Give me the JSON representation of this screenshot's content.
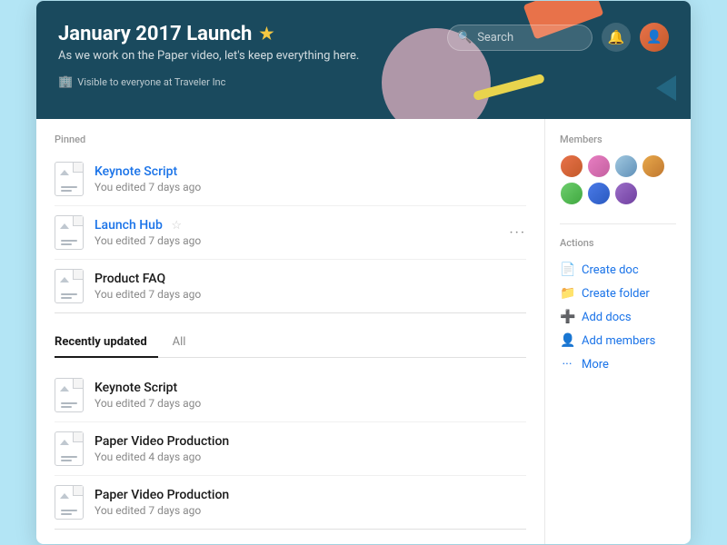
{
  "header": {
    "title": "January 2017 Launch",
    "star": "★",
    "subtitle": "As we work on the Paper video, let's keep everything here.",
    "visibility": "Visible to everyone at Traveler Inc",
    "search_placeholder": "Search",
    "search_label": "Search"
  },
  "pinned": {
    "label": "Pinned",
    "items": [
      {
        "name": "Keynote Script",
        "meta": "You edited 7 days ago",
        "linked": true,
        "has_star": false,
        "has_more": false
      },
      {
        "name": "Launch Hub",
        "meta": "You edited 7 days ago",
        "linked": true,
        "has_star": true,
        "has_more": true
      },
      {
        "name": "Product FAQ",
        "meta": "You edited 7 days ago",
        "linked": false,
        "has_star": false,
        "has_more": false
      }
    ]
  },
  "recently_updated": {
    "tab_recent": "Recently updated",
    "tab_all": "All",
    "items": [
      {
        "name": "Keynote Script",
        "meta": "You edited 7 days ago"
      },
      {
        "name": "Paper Video Production",
        "meta": "You edited 4 days ago"
      },
      {
        "name": "Paper Video Production",
        "meta": "You edited 7 days ago"
      }
    ]
  },
  "sidebar": {
    "members_label": "Members",
    "actions_label": "Actions",
    "actions": [
      {
        "label": "Create doc",
        "icon": "📄"
      },
      {
        "label": "Create folder",
        "icon": "📁"
      },
      {
        "label": "Add docs",
        "icon": "➕"
      },
      {
        "label": "Add members",
        "icon": "👤"
      },
      {
        "label": "More",
        "icon": "···"
      }
    ]
  }
}
